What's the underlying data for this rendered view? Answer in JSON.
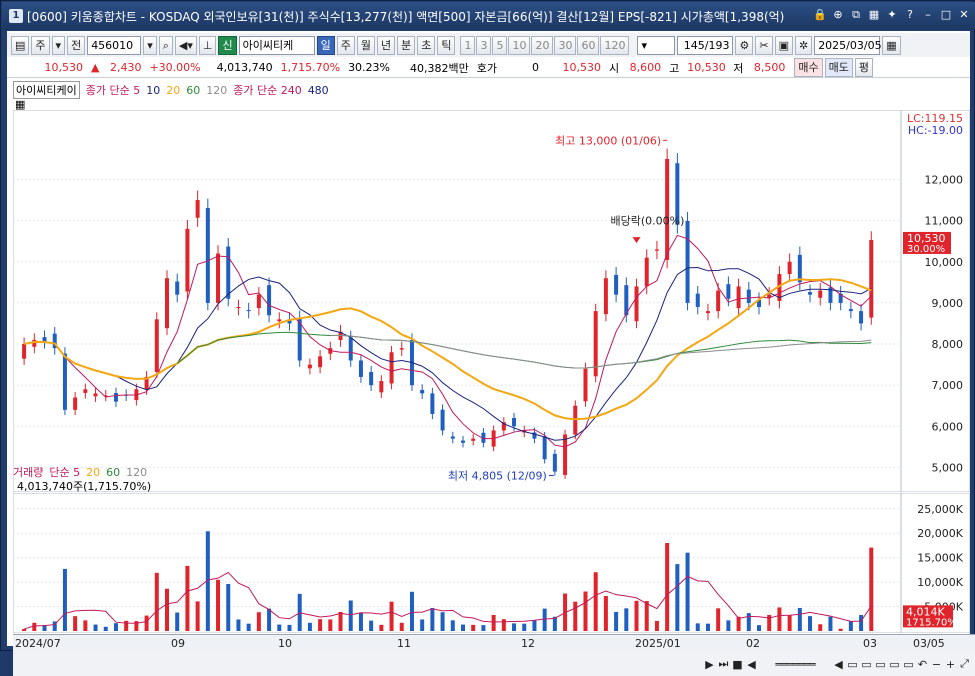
{
  "title": {
    "num": "1",
    "text": "[0600] 키움종합차트 - KOSDAQ 외국인보유[31(천)] 주식수[13,277(천)] 액면[500] 자본금[66(억)] 결산[12월] EPS[-821] 시가총액[1,398(억)"
  },
  "toolbar": {
    "period": "주",
    "prev": "전",
    "code": "456010",
    "name": "아이씨티케",
    "shin": "신",
    "tabs": [
      "일",
      "주",
      "월",
      "년",
      "분",
      "초",
      "틱"
    ],
    "nums": [
      "1",
      "3",
      "5",
      "10",
      "20",
      "30",
      "60",
      "120"
    ],
    "count": "145/193",
    "date": "2025/03/05"
  },
  "quote": {
    "price": "10,530",
    "change": "2,430",
    "pct": "+30.00%",
    "volume": "4,013,740",
    "volpct": "1,715.70%",
    "turnover": "30.23%",
    "amount": "40,382백만",
    "hoga_label": "호가",
    "hoga": "0",
    "bid": "10,530",
    "open_label": "시",
    "open": "8,600",
    "high_label": "고",
    "high": "10,530",
    "low_label": "저",
    "low": "8,500",
    "buy": "매수",
    "sell": "매도",
    "avg": "평"
  },
  "price_legend": {
    "name": "아이씨티케이",
    "ma_label": "종가 단순 5",
    "ma": [
      "10",
      "20",
      "60",
      "120"
    ],
    "ma2_label": "종가 단순 240",
    "ma2": "480",
    "colors": {
      "ma5": "#c2185b",
      "ma10": "#1a237e",
      "ma20": "#f3a712",
      "ma60": "#2e8b3a",
      "ma120": "#8c8c8c"
    }
  },
  "price_axis": {
    "ticks": [
      "12,000",
      "11,000",
      "10,000",
      "9,000",
      "8,000",
      "7,000",
      "6,000",
      "5,000"
    ],
    "lc": "LC:119.15",
    "hc": "HC:-19.00",
    "cur": "10,530",
    "curpct": "30.00%"
  },
  "annot": {
    "high": "최고 13,000 (01/06)",
    "low": "최저 4,805 (12/09)",
    "div": "배당락(0.00%)"
  },
  "vol_legend": {
    "name": "거래량",
    "ma_label": "단순 5",
    "ma": [
      "20",
      "60",
      "120"
    ],
    "value": "4,013,740주(1,715.70%)"
  },
  "vol_axis": {
    "ticks": [
      "25,000K",
      "20,000K",
      "15,000K",
      "10,000K",
      "5,000K"
    ],
    "cur": "4,014K",
    "curpct": "1715.70%"
  },
  "xaxis": {
    "labels": [
      "2024/07",
      "09",
      "10",
      "11",
      "12",
      "2025/01",
      "02",
      "03"
    ],
    "right": "03/05"
  },
  "status": {
    "icons": [
      "▶",
      "▶▶",
      "■",
      "◀"
    ]
  },
  "chart_data": {
    "type": "candlestick",
    "title": "아이씨티케이",
    "ylim": [
      4500,
      13300
    ],
    "high": {
      "value": 13000,
      "date": "01/06"
    },
    "low": {
      "value": 4805,
      "date": "12/09"
    },
    "last_close": 10530,
    "approx_close": [
      8000,
      8100,
      8050,
      7900,
      6400,
      6700,
      6900,
      6800,
      6750,
      6600,
      6750,
      6900,
      7200,
      8600,
      9600,
      9200,
      10800,
      11500,
      9000,
      10200,
      9100,
      8900,
      8800,
      9200,
      8700,
      8600,
      8500,
      7600,
      7500,
      7700,
      7900,
      8300,
      7600,
      7200,
      7000,
      7100,
      7800,
      7900,
      7000,
      6800,
      6300,
      5900,
      5700,
      5600,
      5700,
      5600,
      5900,
      6100,
      6000,
      5900,
      5700,
      5200,
      4900,
      5800,
      6500,
      7400,
      8800,
      9600,
      9200,
      8700,
      9400,
      10100,
      10300,
      12500,
      10900,
      9000,
      8900,
      8800,
      9300,
      9100,
      9400,
      9000,
      8900,
      9200,
      9700,
      10000,
      9500,
      9200,
      9300,
      9000,
      9000,
      8800,
      8500,
      10530
    ],
    "volume_unit": "K",
    "volume_ylim": [
      0,
      27000
    ]
  }
}
